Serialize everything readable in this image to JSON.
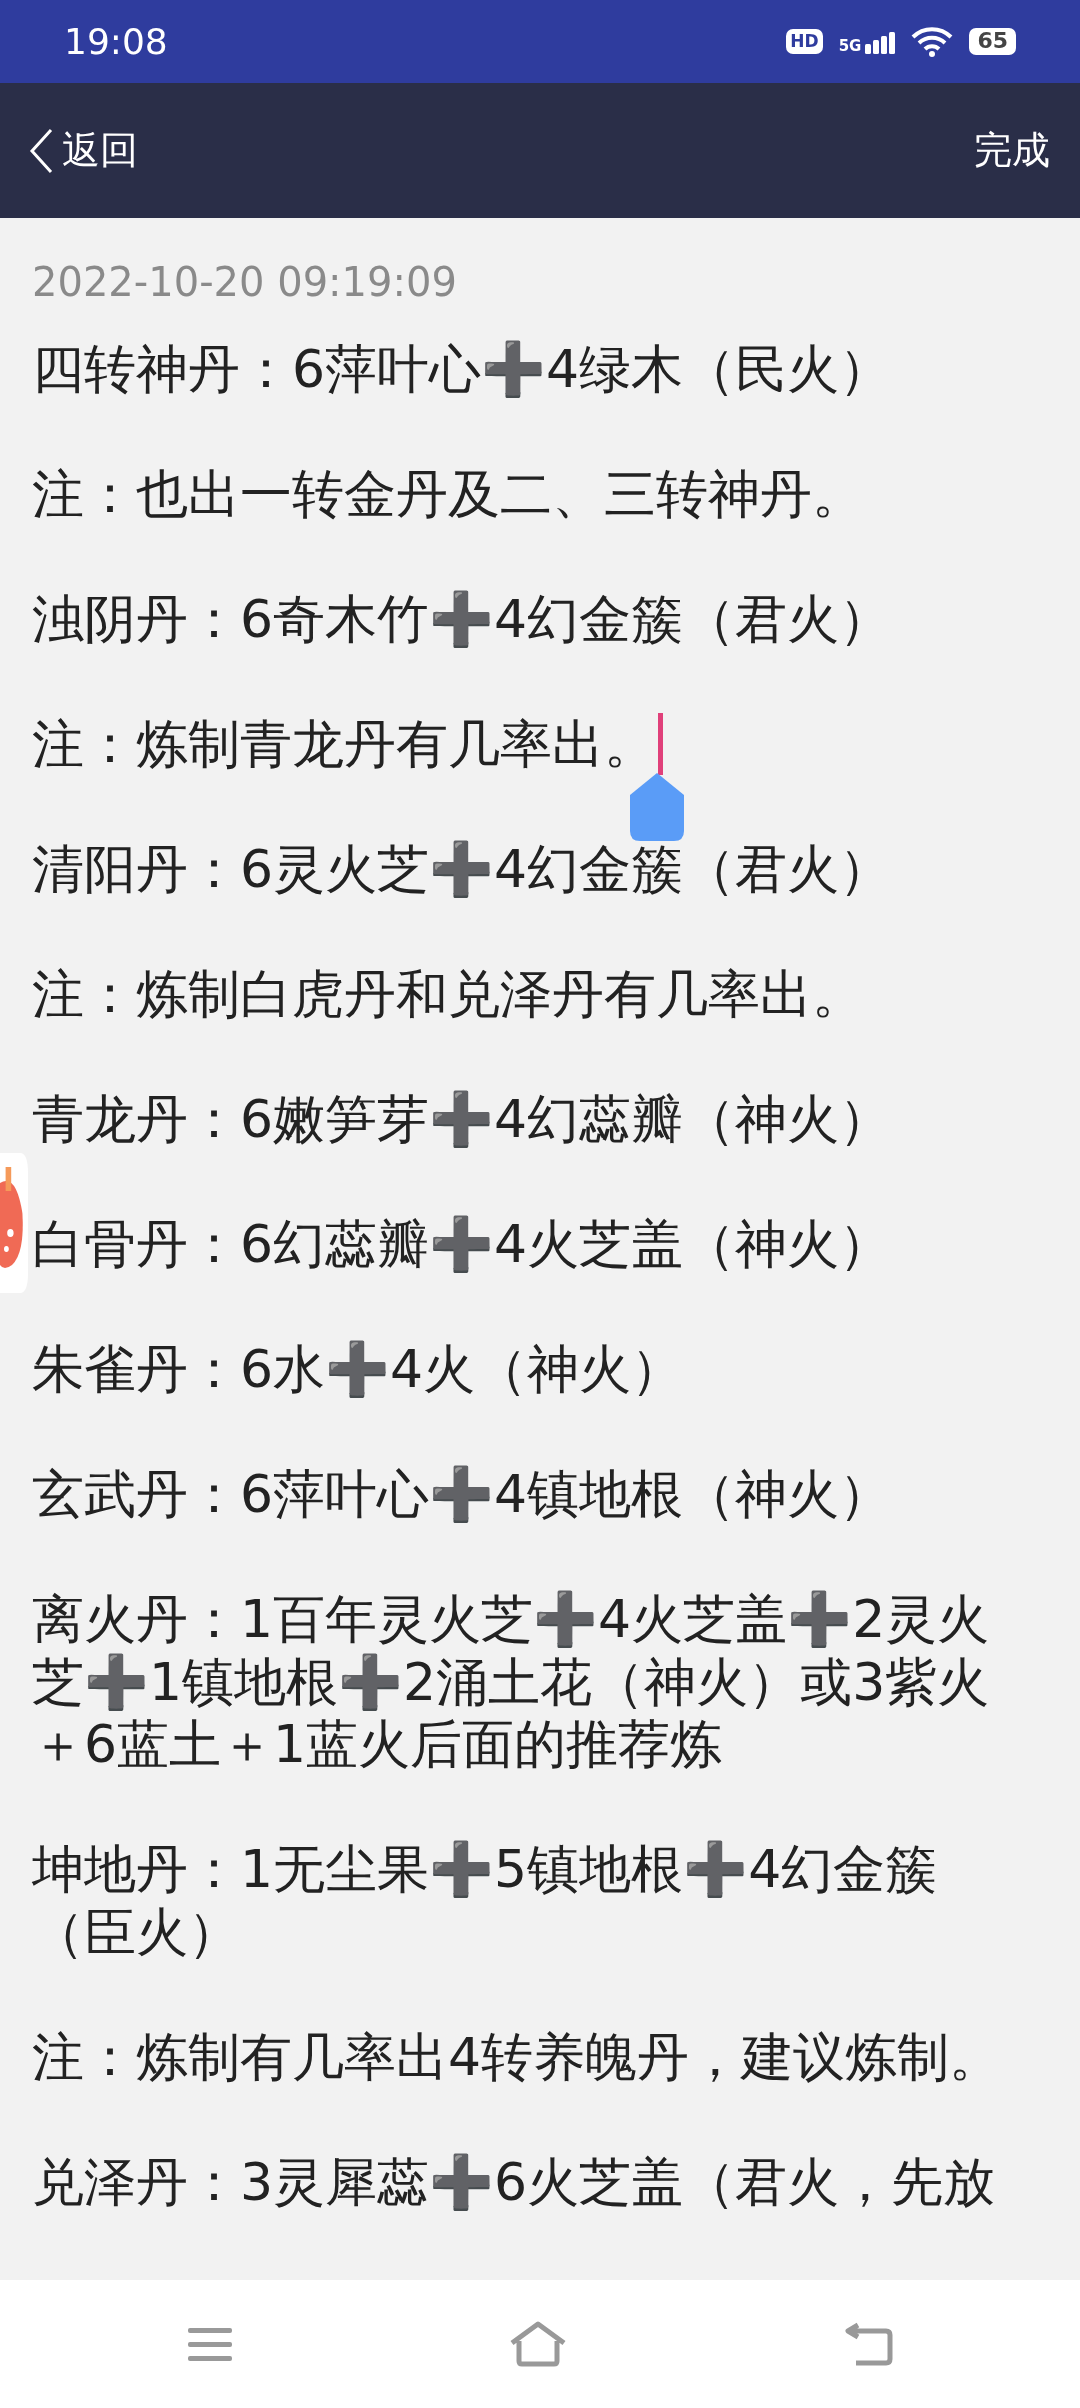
{
  "status_bar": {
    "time": "19:08",
    "hd": "HD",
    "network": "5G",
    "battery": "65"
  },
  "nav": {
    "back": "返回",
    "done": "完成"
  },
  "note": {
    "timestamp": "2022-10-20 09:19:09",
    "paragraphs": [
      {
        "lines": [
          "四转神丹：6萍叶心➕4绿木（民火）"
        ],
        "has_cursor": false
      },
      {
        "lines": [
          "注：也出一转金丹及二、三转神丹。"
        ],
        "has_cursor": false
      },
      {
        "lines": [
          "浊阴丹：6奇木竹➕4幻金簇（君火）"
        ],
        "has_cursor": false
      },
      {
        "lines": [
          "注：炼制青龙丹有几率出。"
        ],
        "has_cursor": true
      },
      {
        "lines": [
          "清阳丹：6灵火芝➕4幻金簇（君火）"
        ],
        "has_cursor": false
      },
      {
        "lines": [
          "注：炼制白虎丹和兑泽丹有几率出。"
        ],
        "has_cursor": false
      },
      {
        "lines": [
          "青龙丹：6嫩笋芽➕4幻蕊瓣（神火）"
        ],
        "has_cursor": false
      },
      {
        "lines": [
          "白骨丹：6幻蕊瓣➕4火芝盖（神火）"
        ],
        "has_cursor": false
      },
      {
        "lines": [
          "朱雀丹：6水➕4火（神火）"
        ],
        "has_cursor": false
      },
      {
        "lines": [
          "玄武丹：6萍叶心➕4镇地根（神火）"
        ],
        "has_cursor": false
      },
      {
        "lines": [
          "离火丹：1百年灵火芝➕4火芝盖➕2灵火",
          "芝➕1镇地根➕2涌土花（神火）或3紫火",
          "＋6蓝土＋1蓝火后面的推荐炼"
        ],
        "has_cursor": false
      },
      {
        "lines": [
          "坤地丹：1无尘果➕5镇地根➕4幻金簇",
          "（臣火）"
        ],
        "has_cursor": false
      },
      {
        "lines": [
          "注：炼制有几率出4转养魄丹，建议炼制。"
        ],
        "has_cursor": false
      },
      {
        "lines": [
          "兑泽丹：3灵犀蕊➕6火芝盖（君火，先放"
        ],
        "has_cursor": false
      }
    ]
  }
}
